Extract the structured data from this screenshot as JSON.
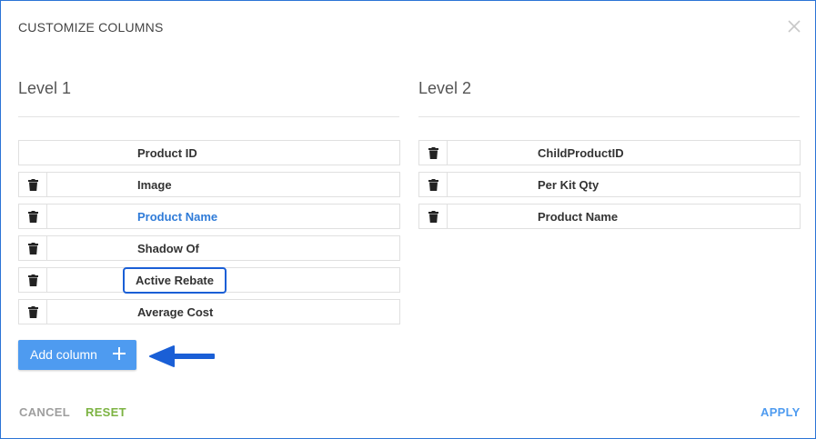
{
  "dialog": {
    "title": "CUSTOMIZE COLUMNS",
    "close_icon": "close-icon"
  },
  "level1": {
    "heading": "Level 1",
    "columns": [
      {
        "label": "Product ID",
        "removable": false
      },
      {
        "label": "Image",
        "removable": true
      },
      {
        "label": "Product Name",
        "removable": true,
        "highlighted_text": true
      },
      {
        "label": "Shadow Of",
        "removable": true
      },
      {
        "label": "Active Rebate",
        "removable": true,
        "boxed": true
      },
      {
        "label": "Average Cost",
        "removable": true
      }
    ],
    "add_button": "Add column"
  },
  "level2": {
    "heading": "Level 2",
    "columns": [
      {
        "label": "ChildProductID",
        "removable": true
      },
      {
        "label": "Per Kit Qty",
        "removable": true
      },
      {
        "label": "Product Name",
        "removable": true
      }
    ]
  },
  "footer": {
    "cancel": "CANCEL",
    "reset": "RESET",
    "apply": "APPLY"
  },
  "colors": {
    "accent": "#4e9bf0",
    "link": "#2f7bd8",
    "reset": "#7cb342",
    "cancel": "#9e9e9e",
    "annotation": "#1a5fd6"
  }
}
